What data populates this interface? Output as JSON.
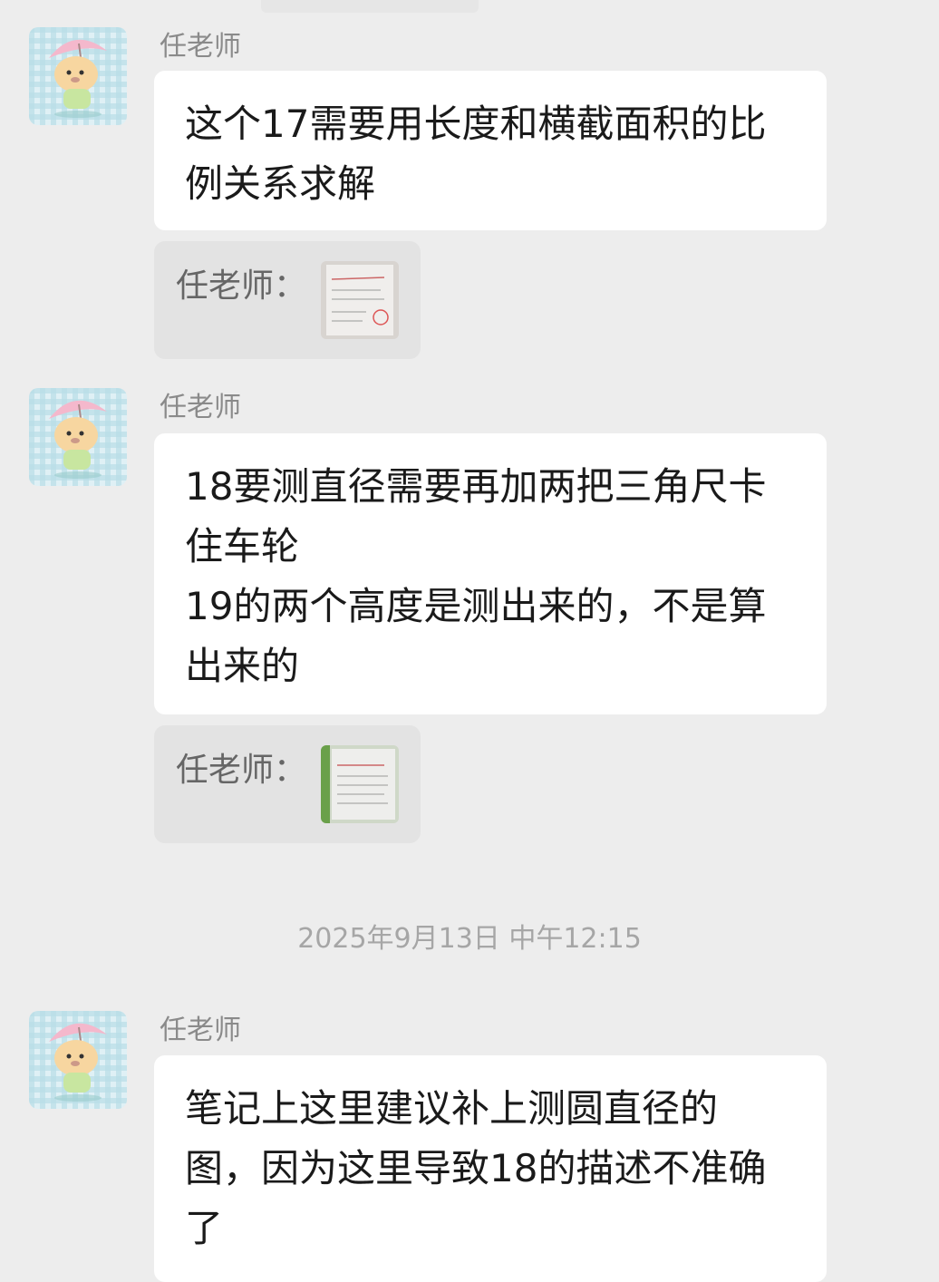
{
  "messages": [
    {
      "sender": "任老师",
      "lines": [
        "这个17需要用长度和横截面积的比",
        "例关系求解"
      ],
      "quote": {
        "label": "任老师："
      }
    },
    {
      "sender": "任老师",
      "lines": [
        "18要测直径需要再加两把三角尺卡",
        "住车轮",
        "19的两个高度是测出来的，不是算",
        "出来的"
      ],
      "quote": {
        "label": "任老师："
      }
    }
  ],
  "timestamp": "2025年9月13日 中午12:15",
  "messages2": [
    {
      "sender": "任老师",
      "lines": [
        "笔记上这里建议补上测圆直径的",
        "图，因为这里导致18的描述不准确",
        "了"
      ]
    }
  ],
  "colors": {
    "background": "#ededed",
    "bubble": "#ffffff",
    "quote_bg": "#e3e3e3",
    "sender": "#8a8a8a"
  }
}
